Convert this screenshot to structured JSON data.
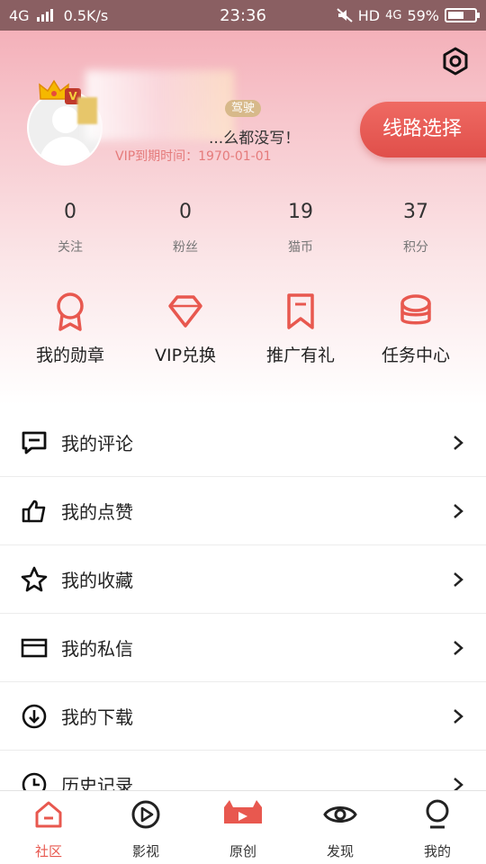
{
  "status_bar": {
    "network": "4G",
    "speed": "0.5K/s",
    "time": "23:36",
    "hd": "HD",
    "net2": "4G",
    "battery": "59%",
    "battery_level": 0.59
  },
  "profile": {
    "level_badge": "驾驶",
    "signature": "...么都没写！",
    "vip_expire": "VIP到期时间：1970-01-01",
    "line_select_label": "线路选择"
  },
  "stats": [
    {
      "value": "0",
      "label": "关注"
    },
    {
      "value": "0",
      "label": "粉丝"
    },
    {
      "value": "19",
      "label": "猫币"
    },
    {
      "value": "37",
      "label": "积分"
    }
  ],
  "actions": [
    {
      "label": "我的勋章",
      "icon": "medal-icon"
    },
    {
      "label": "VIP兑换",
      "icon": "diamond-icon"
    },
    {
      "label": "推广有礼",
      "icon": "bookmark-icon"
    },
    {
      "label": "任务中心",
      "icon": "coins-icon"
    }
  ],
  "menu": [
    {
      "label": "我的评论",
      "icon": "comment-icon"
    },
    {
      "label": "我的点赞",
      "icon": "thumbs-up-icon"
    },
    {
      "label": "我的收藏",
      "icon": "star-icon"
    },
    {
      "label": "我的私信",
      "icon": "mail-icon"
    },
    {
      "label": "我的下载",
      "icon": "download-icon"
    },
    {
      "label": "历史记录",
      "icon": "clock-icon"
    }
  ],
  "tabs": [
    {
      "label": "社区",
      "icon": "home-icon",
      "active": true
    },
    {
      "label": "影视",
      "icon": "play-icon",
      "active": false
    },
    {
      "label": "原创",
      "icon": "original-icon",
      "active": false
    },
    {
      "label": "发现",
      "icon": "eye-icon",
      "active": false
    },
    {
      "label": "我的",
      "icon": "profile-icon",
      "active": false
    }
  ],
  "colors": {
    "accent": "#e8584f",
    "status_bar": "#8a5f62",
    "vip_text": "#e57b7b"
  }
}
